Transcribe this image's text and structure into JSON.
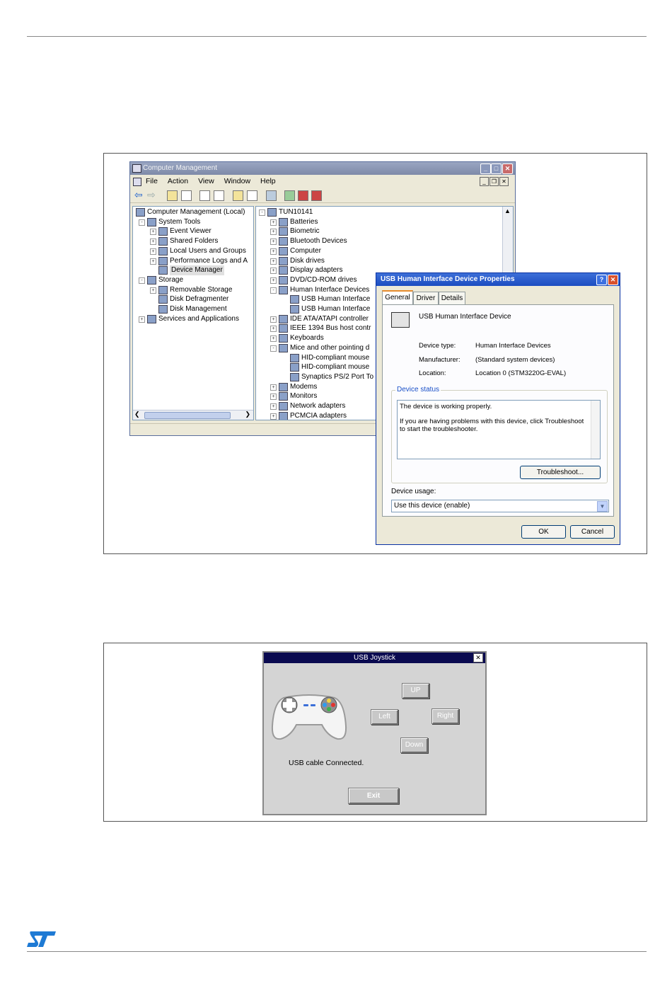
{
  "computer_management": {
    "title": "Computer Management",
    "menu": [
      "File",
      "Action",
      "View",
      "Window",
      "Help"
    ],
    "left_tree": [
      {
        "label": "Computer Management (Local)",
        "level": 0,
        "expander": ""
      },
      {
        "label": "System Tools",
        "level": 1,
        "expander": "-"
      },
      {
        "label": "Event Viewer",
        "level": 2,
        "expander": "+"
      },
      {
        "label": "Shared Folders",
        "level": 2,
        "expander": "+"
      },
      {
        "label": "Local Users and Groups",
        "level": 2,
        "expander": "+"
      },
      {
        "label": "Performance Logs and A",
        "level": 2,
        "expander": "+"
      },
      {
        "label": "Device Manager",
        "level": 2,
        "expander": ""
      },
      {
        "label": "Storage",
        "level": 1,
        "expander": "-"
      },
      {
        "label": "Removable Storage",
        "level": 2,
        "expander": "+"
      },
      {
        "label": "Disk Defragmenter",
        "level": 2,
        "expander": ""
      },
      {
        "label": "Disk Management",
        "level": 2,
        "expander": ""
      },
      {
        "label": "Services and Applications",
        "level": 1,
        "expander": "+"
      }
    ],
    "right_tree": [
      {
        "label": "TUN10141",
        "level": 0,
        "expander": "-"
      },
      {
        "label": "Batteries",
        "level": 1,
        "expander": "+"
      },
      {
        "label": "Biometric",
        "level": 1,
        "expander": "+"
      },
      {
        "label": "Bluetooth Devices",
        "level": 1,
        "expander": "+"
      },
      {
        "label": "Computer",
        "level": 1,
        "expander": "+"
      },
      {
        "label": "Disk drives",
        "level": 1,
        "expander": "+"
      },
      {
        "label": "Display adapters",
        "level": 1,
        "expander": "+"
      },
      {
        "label": "DVD/CD-ROM drives",
        "level": 1,
        "expander": "+"
      },
      {
        "label": "Human Interface Devices",
        "level": 1,
        "expander": "-"
      },
      {
        "label": "USB Human Interface",
        "level": 2,
        "expander": ""
      },
      {
        "label": "USB Human Interface",
        "level": 2,
        "expander": ""
      },
      {
        "label": "IDE ATA/ATAPI controller",
        "level": 1,
        "expander": "+"
      },
      {
        "label": "IEEE 1394 Bus host contr",
        "level": 1,
        "expander": "+"
      },
      {
        "label": "Keyboards",
        "level": 1,
        "expander": "+"
      },
      {
        "label": "Mice and other pointing d",
        "level": 1,
        "expander": "-"
      },
      {
        "label": "HID-compliant mouse",
        "level": 2,
        "expander": ""
      },
      {
        "label": "HID-compliant mouse",
        "level": 2,
        "expander": ""
      },
      {
        "label": "Synaptics PS/2 Port To",
        "level": 2,
        "expander": ""
      },
      {
        "label": "Modems",
        "level": 1,
        "expander": "+"
      },
      {
        "label": "Monitors",
        "level": 1,
        "expander": "+"
      },
      {
        "label": "Network adapters",
        "level": 1,
        "expander": "+"
      },
      {
        "label": "PCMCIA adapters",
        "level": 1,
        "expander": "+"
      }
    ]
  },
  "properties_dialog": {
    "title": "USB Human Interface Device Properties",
    "tabs": [
      "General",
      "Driver",
      "Details"
    ],
    "device_name": "USB Human Interface Device",
    "fields": [
      {
        "label": "Device type:",
        "value": "Human Interface Devices"
      },
      {
        "label": "Manufacturer:",
        "value": "(Standard system devices)"
      },
      {
        "label": "Location:",
        "value": "Location 0 (STM3220G-EVAL)"
      }
    ],
    "status_group": "Device status",
    "status_line1": "The device is working properly.",
    "status_line2": "If you are having problems with this device, click Troubleshoot to start the troubleshooter.",
    "troubleshoot_label": "Troubleshoot...",
    "usage_label": "Device usage:",
    "usage_value": "Use this device (enable)",
    "ok_label": "OK",
    "cancel_label": "Cancel"
  },
  "joystick": {
    "title": "USB Joystick",
    "up": "UP",
    "left": "Left",
    "right": "Right",
    "down": "Down",
    "status": "USB cable Connected.",
    "exit": "Exit"
  },
  "colors": {
    "xp_title_active": "#1b4cc1",
    "xp_face": "#ece9d8",
    "joystick_title": "#0a0a50",
    "st_logo": "#1e7ad4"
  }
}
